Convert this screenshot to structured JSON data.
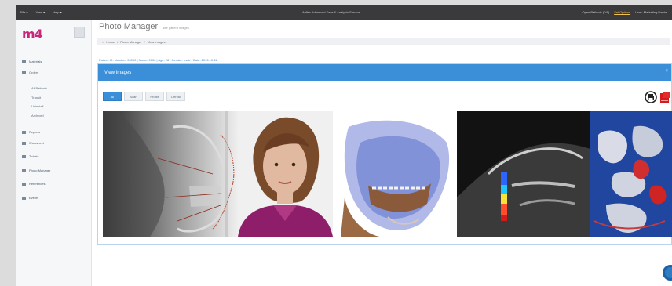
{
  "topbar": {
    "menus": [
      "File ▾",
      "View ▾",
      "Help ▾"
    ],
    "center_text": "Ayflex Advanced Face & Analysis Service",
    "right": {
      "item1": "Open Patients (0/1)",
      "item2": "Set Options",
      "item3": "User: Marketing Dental"
    }
  },
  "sidebar": {
    "logo": "m4",
    "items": {
      "materials": "Materials",
      "orders": "Orders",
      "all_patients": "All Patients",
      "transit": "Transit",
      "uninstall": "Uninstall",
      "archived": "Archived",
      "reports": "Reports",
      "worksheet": "Worksheet",
      "tickets": "Tickets",
      "photo_manager": "Photo Manager",
      "references": "References",
      "events": "Events"
    }
  },
  "page": {
    "title": "Photo Manager",
    "subtitle": "see patient images",
    "breadcrumb": {
      "home": "Home",
      "sep": "/",
      "section": "Photo Manager",
      "current": "View Images"
    },
    "patient_info": "Patient ID: Number: 00000 | Name: 0000 | Age: 28 | Gender: male | Date: 2016.10.11"
  },
  "panel": {
    "title": "View Images",
    "close": "×",
    "filters": [
      "All",
      "Scan",
      "Profile",
      "Dental"
    ]
  }
}
